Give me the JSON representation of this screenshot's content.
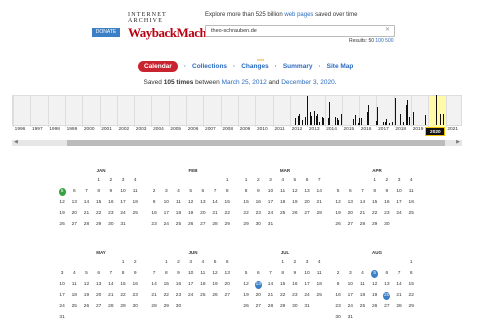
{
  "header": {
    "donate_label": "DONATE",
    "logo_top": "INTERNET ARCHIVE",
    "logo_main": "WaybackMachine",
    "tagline_pre": "Explore more than 525 billion ",
    "tagline_link": "web pages",
    "tagline_post": " saved over time",
    "search_value": "theo-schrauben.de",
    "results_pre": "Results: 50 ",
    "results_link": "100 500"
  },
  "nav": {
    "calendar": "Calendar",
    "collections": "Collections",
    "changes": "Changes",
    "changes_badge": "beta",
    "summary": "Summary",
    "sitemap": "Site Map"
  },
  "saved": {
    "pre": "Saved ",
    "count": "105 times",
    "mid": " between ",
    "start": "March 25, 2012",
    "and": " and ",
    "end": "December 3, 2020",
    "post": "."
  },
  "timeline": {
    "years": [
      "1996",
      "1997",
      "1998",
      "1999",
      "2000",
      "2001",
      "2002",
      "2003",
      "2004",
      "2005",
      "2006",
      "2007",
      "2008",
      "2009",
      "2010",
      "2011",
      "2012",
      "2013",
      "2014",
      "2015",
      "2016",
      "2017",
      "2018",
      "2019",
      "2020",
      "2021"
    ],
    "selected_year": "2020"
  },
  "calendar": {
    "year": "2020",
    "months": [
      {
        "name": "JAN",
        "start": 3,
        "days": 31,
        "green": [
          5
        ],
        "blue": []
      },
      {
        "name": "FEB",
        "start": 6,
        "days": 29,
        "green": [],
        "blue": []
      },
      {
        "name": "MAR",
        "start": 0,
        "days": 31,
        "green": [],
        "blue": []
      },
      {
        "name": "APR",
        "start": 3,
        "days": 30,
        "green": [],
        "blue": []
      },
      {
        "name": "MAY",
        "start": 5,
        "days": 31,
        "green": [],
        "blue": []
      },
      {
        "name": "JUN",
        "start": 1,
        "days": 30,
        "green": [],
        "blue": []
      },
      {
        "name": "JUL",
        "start": 3,
        "days": 31,
        "green": [],
        "blue": [
          13
        ]
      },
      {
        "name": "AUG",
        "start": 6,
        "days": 31,
        "green": [],
        "blue": [
          5,
          20
        ]
      }
    ]
  },
  "colors": {
    "accent": "#c8242f",
    "link": "#2a6bbf",
    "capture_green": "#37a040",
    "capture_blue": "#3b7fc4"
  }
}
